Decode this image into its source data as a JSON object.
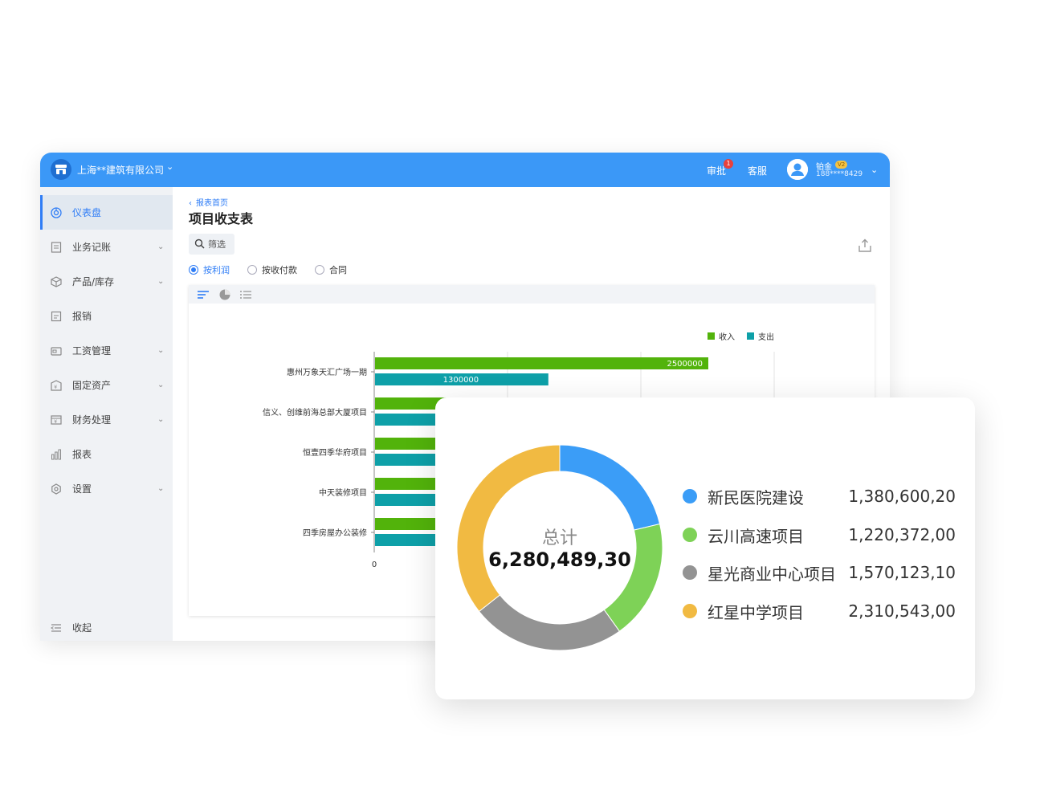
{
  "topbar": {
    "company": "上海**建筑有限公司",
    "approve": "审批",
    "approve_badge": "1",
    "service": "客服",
    "user_name": "铂金",
    "user_level": "V2",
    "phone": "188****8429"
  },
  "sidebar": {
    "items": [
      {
        "label": "仪表盘",
        "icon": "dashboard-icon",
        "active": true,
        "has_children": false
      },
      {
        "label": "业务记账",
        "icon": "ledger-icon",
        "active": false,
        "has_children": true
      },
      {
        "label": "产品/库存",
        "icon": "box-icon",
        "active": false,
        "has_children": true
      },
      {
        "label": "报销",
        "icon": "receipt-icon",
        "active": false,
        "has_children": false
      },
      {
        "label": "工资管理",
        "icon": "wallet-icon",
        "active": false,
        "has_children": true
      },
      {
        "label": "固定资产",
        "icon": "asset-icon",
        "active": false,
        "has_children": true
      },
      {
        "label": "财务处理",
        "icon": "finance-icon",
        "active": false,
        "has_children": true
      },
      {
        "label": "报表",
        "icon": "bar-chart-icon",
        "active": false,
        "has_children": false
      },
      {
        "label": "设置",
        "icon": "gear-icon",
        "active": false,
        "has_children": true
      }
    ],
    "collapse_label": "收起"
  },
  "content": {
    "breadcrumb": "报表首页",
    "title": "项目收支表",
    "filter_label": "筛选",
    "radios": [
      {
        "label": "按利润",
        "checked": true
      },
      {
        "label": "按收付款",
        "checked": false
      },
      {
        "label": "合同",
        "checked": false
      }
    ]
  },
  "colors": {
    "primary": "#3b98f7",
    "income": "#52b30b",
    "expense": "#0ea0a8"
  },
  "chart_data": [
    {
      "type": "bar",
      "orientation": "horizontal",
      "categories": [
        "惠州万象天汇广场一期",
        "信义、创维前海总部大厦项目",
        "恒壹四季华府项目",
        "中天装修项目",
        "四季房屋办公装修"
      ],
      "series": [
        {
          "name": "收入",
          "values": [
            2500000,
            null,
            null,
            null,
            null
          ]
        },
        {
          "name": "支出",
          "values": [
            1300000,
            null,
            null,
            null,
            null
          ]
        }
      ],
      "data_labels": [
        "2500000",
        "1300000"
      ],
      "x_tick_labels": [
        "0"
      ],
      "xlim": [
        0,
        3000000
      ],
      "legend": "top-right",
      "grid": true
    },
    {
      "type": "pie",
      "donut": true,
      "center_label": "总计",
      "center_value": "6,280,489,30",
      "slices": [
        {
          "name": "新民医院建设",
          "value": 1380600.2,
          "display": "1,380,600,20",
          "color": "#3b9df7"
        },
        {
          "name": "云川高速项目",
          "value": 1220372.0,
          "display": "1,220,372,00",
          "color": "#7ed257"
        },
        {
          "name": "星光商业中心项目",
          "value": 1570123.1,
          "display": "1,570,123,10",
          "color": "#939393"
        },
        {
          "name": "红星中学项目",
          "value": 2310543.0,
          "display": "2,310,543,00",
          "color": "#f1ba42"
        }
      ]
    }
  ]
}
